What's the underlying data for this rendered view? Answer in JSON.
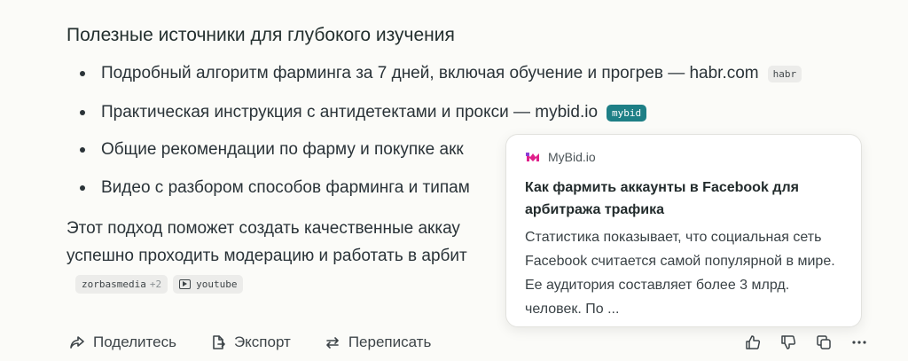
{
  "heading": "Полезные источники для глубокого изучения",
  "bullets": [
    {
      "text": "Подробный алгоритм фарминга за 7 дней, включая обучение и прогрев — habr.com",
      "tag": "habr"
    },
    {
      "text": "Практическая инструкция с антидетектами и прокси — mybid.io",
      "tag": "mybid"
    },
    {
      "text": "Общие рекомендации по фарму и покупке акк"
    },
    {
      "text": "Видео с разбором способов фарминга и типам"
    }
  ],
  "paragraph": {
    "line1": "Этот подход поможет создать качественные аккау",
    "line2": "успешно проходить модерацию и работать в арбит"
  },
  "chips": {
    "zorbas": "zorbasmedia",
    "zorbas_more": "+2",
    "youtube": "youtube"
  },
  "popup": {
    "source": "MyBid.io",
    "title": "Как фармить аккаунты в Facebook для арбитража трафика",
    "description": "Статистика показывает, что социальная сеть Facebook считается самой популярной в мире. Ее аудитория составляет более 3 млрд. человек. По ..."
  },
  "actions": {
    "share": "Поделитесь",
    "export": "Экспорт",
    "rewrite": "Переписать"
  },
  "colors": {
    "accent_teal": "#1e7f86",
    "logo_magenta": "#e0208a"
  }
}
